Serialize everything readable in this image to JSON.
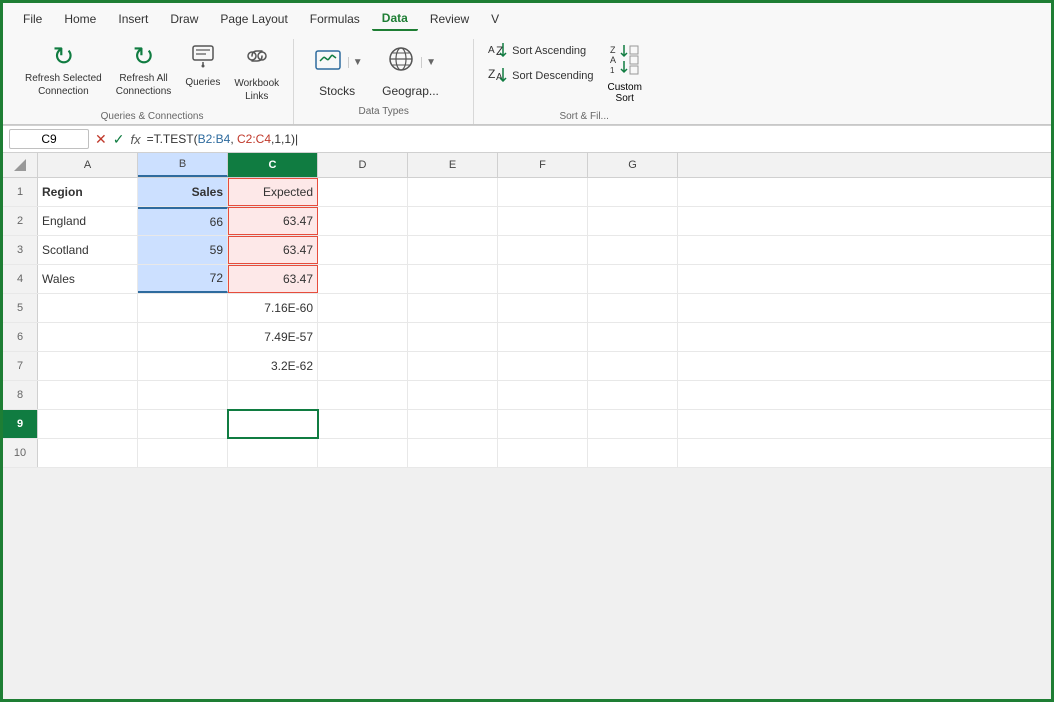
{
  "menu": {
    "items": [
      "File",
      "Home",
      "Insert",
      "Draw",
      "Page Layout",
      "Formulas",
      "Data",
      "Review",
      "V"
    ],
    "active": "Data"
  },
  "ribbon": {
    "groups": {
      "queries_connections": {
        "label": "Queries & Connections",
        "buttons": [
          {
            "id": "refresh-selected",
            "icon": "↻",
            "label": "Refresh Selected\nConnection"
          },
          {
            "id": "refresh-all",
            "icon": "↻",
            "label": "Refresh All\nConnections"
          },
          {
            "id": "queries",
            "icon": "⊞",
            "label": "Queries"
          },
          {
            "id": "workbook-links",
            "icon": "⛓",
            "label": "Workbook\nLinks"
          }
        ]
      },
      "data_types": {
        "label": "Data Types",
        "stocks_label": "Stocks",
        "geography_label": "Geograp..."
      },
      "sort_filter": {
        "label": "Sort & Fil...",
        "sort_ascending": "Sort Ascending",
        "sort_descending": "Sort Descending",
        "custom_label": "Custom\nSort"
      }
    }
  },
  "formula_bar": {
    "cell_ref": "C9",
    "formula": "=T.TEST(B2:B4, C2:C4,1,1)"
  },
  "columns": [
    "",
    "A",
    "B",
    "C",
    "D",
    "E",
    "F",
    "G"
  ],
  "rows": [
    {
      "num": "1",
      "a": "Region",
      "b": "Sales",
      "c": "Expected",
      "d": "",
      "e": "",
      "f": "",
      "g": ""
    },
    {
      "num": "2",
      "a": "England",
      "b": "66",
      "c": "63.47",
      "d": "",
      "e": "",
      "f": "",
      "g": ""
    },
    {
      "num": "3",
      "a": "Scotland",
      "b": "59",
      "c": "63.47",
      "d": "",
      "e": "",
      "f": "",
      "g": ""
    },
    {
      "num": "4",
      "a": "Wales",
      "b": "72",
      "c": "63.47",
      "d": "",
      "e": "",
      "f": "",
      "g": ""
    },
    {
      "num": "5",
      "a": "",
      "b": "",
      "c": "7.16E-60",
      "d": "",
      "e": "",
      "f": "",
      "g": ""
    },
    {
      "num": "6",
      "a": "",
      "b": "",
      "c": "7.49E-57",
      "d": "",
      "e": "",
      "f": "",
      "g": ""
    },
    {
      "num": "7",
      "a": "",
      "b": "",
      "c": "3.2E-62",
      "d": "",
      "e": "",
      "f": "",
      "g": ""
    },
    {
      "num": "8",
      "a": "",
      "b": "",
      "c": "",
      "d": "",
      "e": "",
      "f": "",
      "g": ""
    },
    {
      "num": "9",
      "a": "",
      "b": "",
      "c": "",
      "d": "",
      "e": "",
      "f": "",
      "g": ""
    },
    {
      "num": "10",
      "a": "",
      "b": "",
      "c": "",
      "d": "",
      "e": "",
      "f": "",
      "g": ""
    }
  ],
  "formula_preview": "=T.TEST(B2:B4, C2:C4,1,1)",
  "colors": {
    "green_accent": "#107c41",
    "selection_blue": "#2e6b9e",
    "selection_red": "#c0392b"
  }
}
